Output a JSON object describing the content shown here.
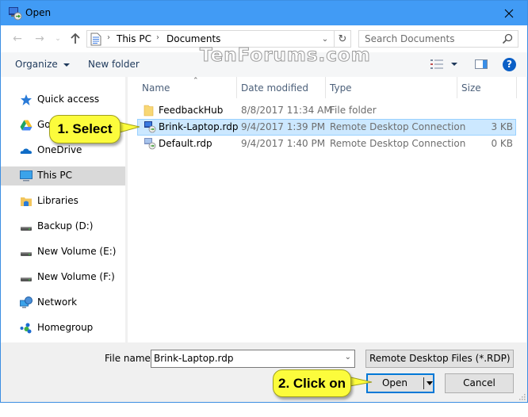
{
  "window": {
    "title": "Open",
    "accent_color": "#419bf5"
  },
  "navigation": {
    "breadcrumbs": [
      "This PC",
      "Documents"
    ],
    "search_placeholder": "Search Documents"
  },
  "toolbar": {
    "organize_label": "Organize",
    "new_folder_label": "New folder",
    "help_label": "?"
  },
  "watermark": "TenForums.com",
  "sidebar": {
    "items": [
      {
        "label": "Quick access",
        "icon": "star-icon",
        "selected": false
      },
      {
        "label": "Google Drive",
        "icon": "google-drive-icon",
        "selected": false
      },
      {
        "label": "OneDrive",
        "icon": "onedrive-icon",
        "selected": false
      },
      {
        "label": "This PC",
        "icon": "computer-icon",
        "selected": true
      },
      {
        "label": "Libraries",
        "icon": "libraries-icon",
        "selected": false
      },
      {
        "label": "Backup (D:)",
        "icon": "drive-icon",
        "selected": false
      },
      {
        "label": "New Volume (E:)",
        "icon": "drive-icon",
        "selected": false
      },
      {
        "label": "New Volume (F:)",
        "icon": "drive-icon",
        "selected": false
      },
      {
        "label": "Network",
        "icon": "network-icon",
        "selected": false
      },
      {
        "label": "Homegroup",
        "icon": "homegroup-icon",
        "selected": false
      }
    ]
  },
  "file_list": {
    "columns": [
      "Name",
      "Date modified",
      "Type",
      "Size"
    ],
    "sort_column": "Name",
    "rows": [
      {
        "name": "FeedbackHub",
        "date": "8/8/2017 11:34 AM",
        "type": "File folder",
        "size": "",
        "icon": "folder-icon",
        "selected": false
      },
      {
        "name": "Brink-Laptop.rdp",
        "date": "9/4/2017 1:39 PM",
        "type": "Remote Desktop Connection",
        "size": "3 KB",
        "icon": "rdp-file-icon",
        "selected": true
      },
      {
        "name": "Default.rdp",
        "date": "9/4/2017 1:40 PM",
        "type": "Remote Desktop Connection",
        "size": "0 KB",
        "icon": "rdp-file-icon",
        "selected": false
      }
    ]
  },
  "bottom": {
    "file_name_label": "File name:",
    "file_name_value": "Brink-Laptop.rdp",
    "file_type_value": "Remote Desktop Files (*.RDP)",
    "open_label": "Open",
    "cancel_label": "Cancel"
  },
  "callouts": {
    "step1": "1. Select",
    "step2": "2. Click on",
    "color": "#fcfc3c"
  }
}
